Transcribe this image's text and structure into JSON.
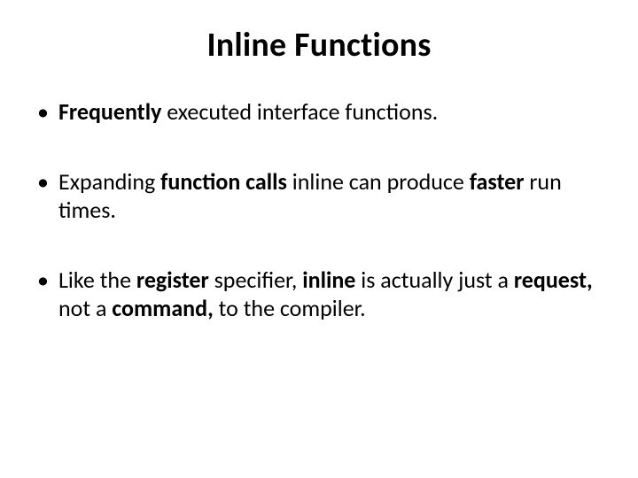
{
  "title": "Inline Functions",
  "bullets": [
    {
      "segments": [
        {
          "text": "Frequently",
          "bold": true
        },
        {
          "text": " executed interface functions.",
          "bold": false
        }
      ]
    },
    {
      "segments": [
        {
          "text": "Expanding ",
          "bold": false
        },
        {
          "text": "function calls",
          "bold": true
        },
        {
          "text": " inline can produce ",
          "bold": false
        },
        {
          "text": "faster",
          "bold": true
        },
        {
          "text": " run times.",
          "bold": false
        }
      ]
    },
    {
      "segments": [
        {
          "text": "Like the ",
          "bold": false
        },
        {
          "text": "register",
          "bold": true
        },
        {
          "text": " specifier, ",
          "bold": false
        },
        {
          "text": "inline",
          "bold": true
        },
        {
          "text": " is actually just a ",
          "bold": false
        },
        {
          "text": "request,",
          "bold": true
        },
        {
          "text": " not a ",
          "bold": false
        },
        {
          "text": "command,",
          "bold": true
        },
        {
          "text": "  to the compiler.",
          "bold": false
        }
      ]
    }
  ]
}
